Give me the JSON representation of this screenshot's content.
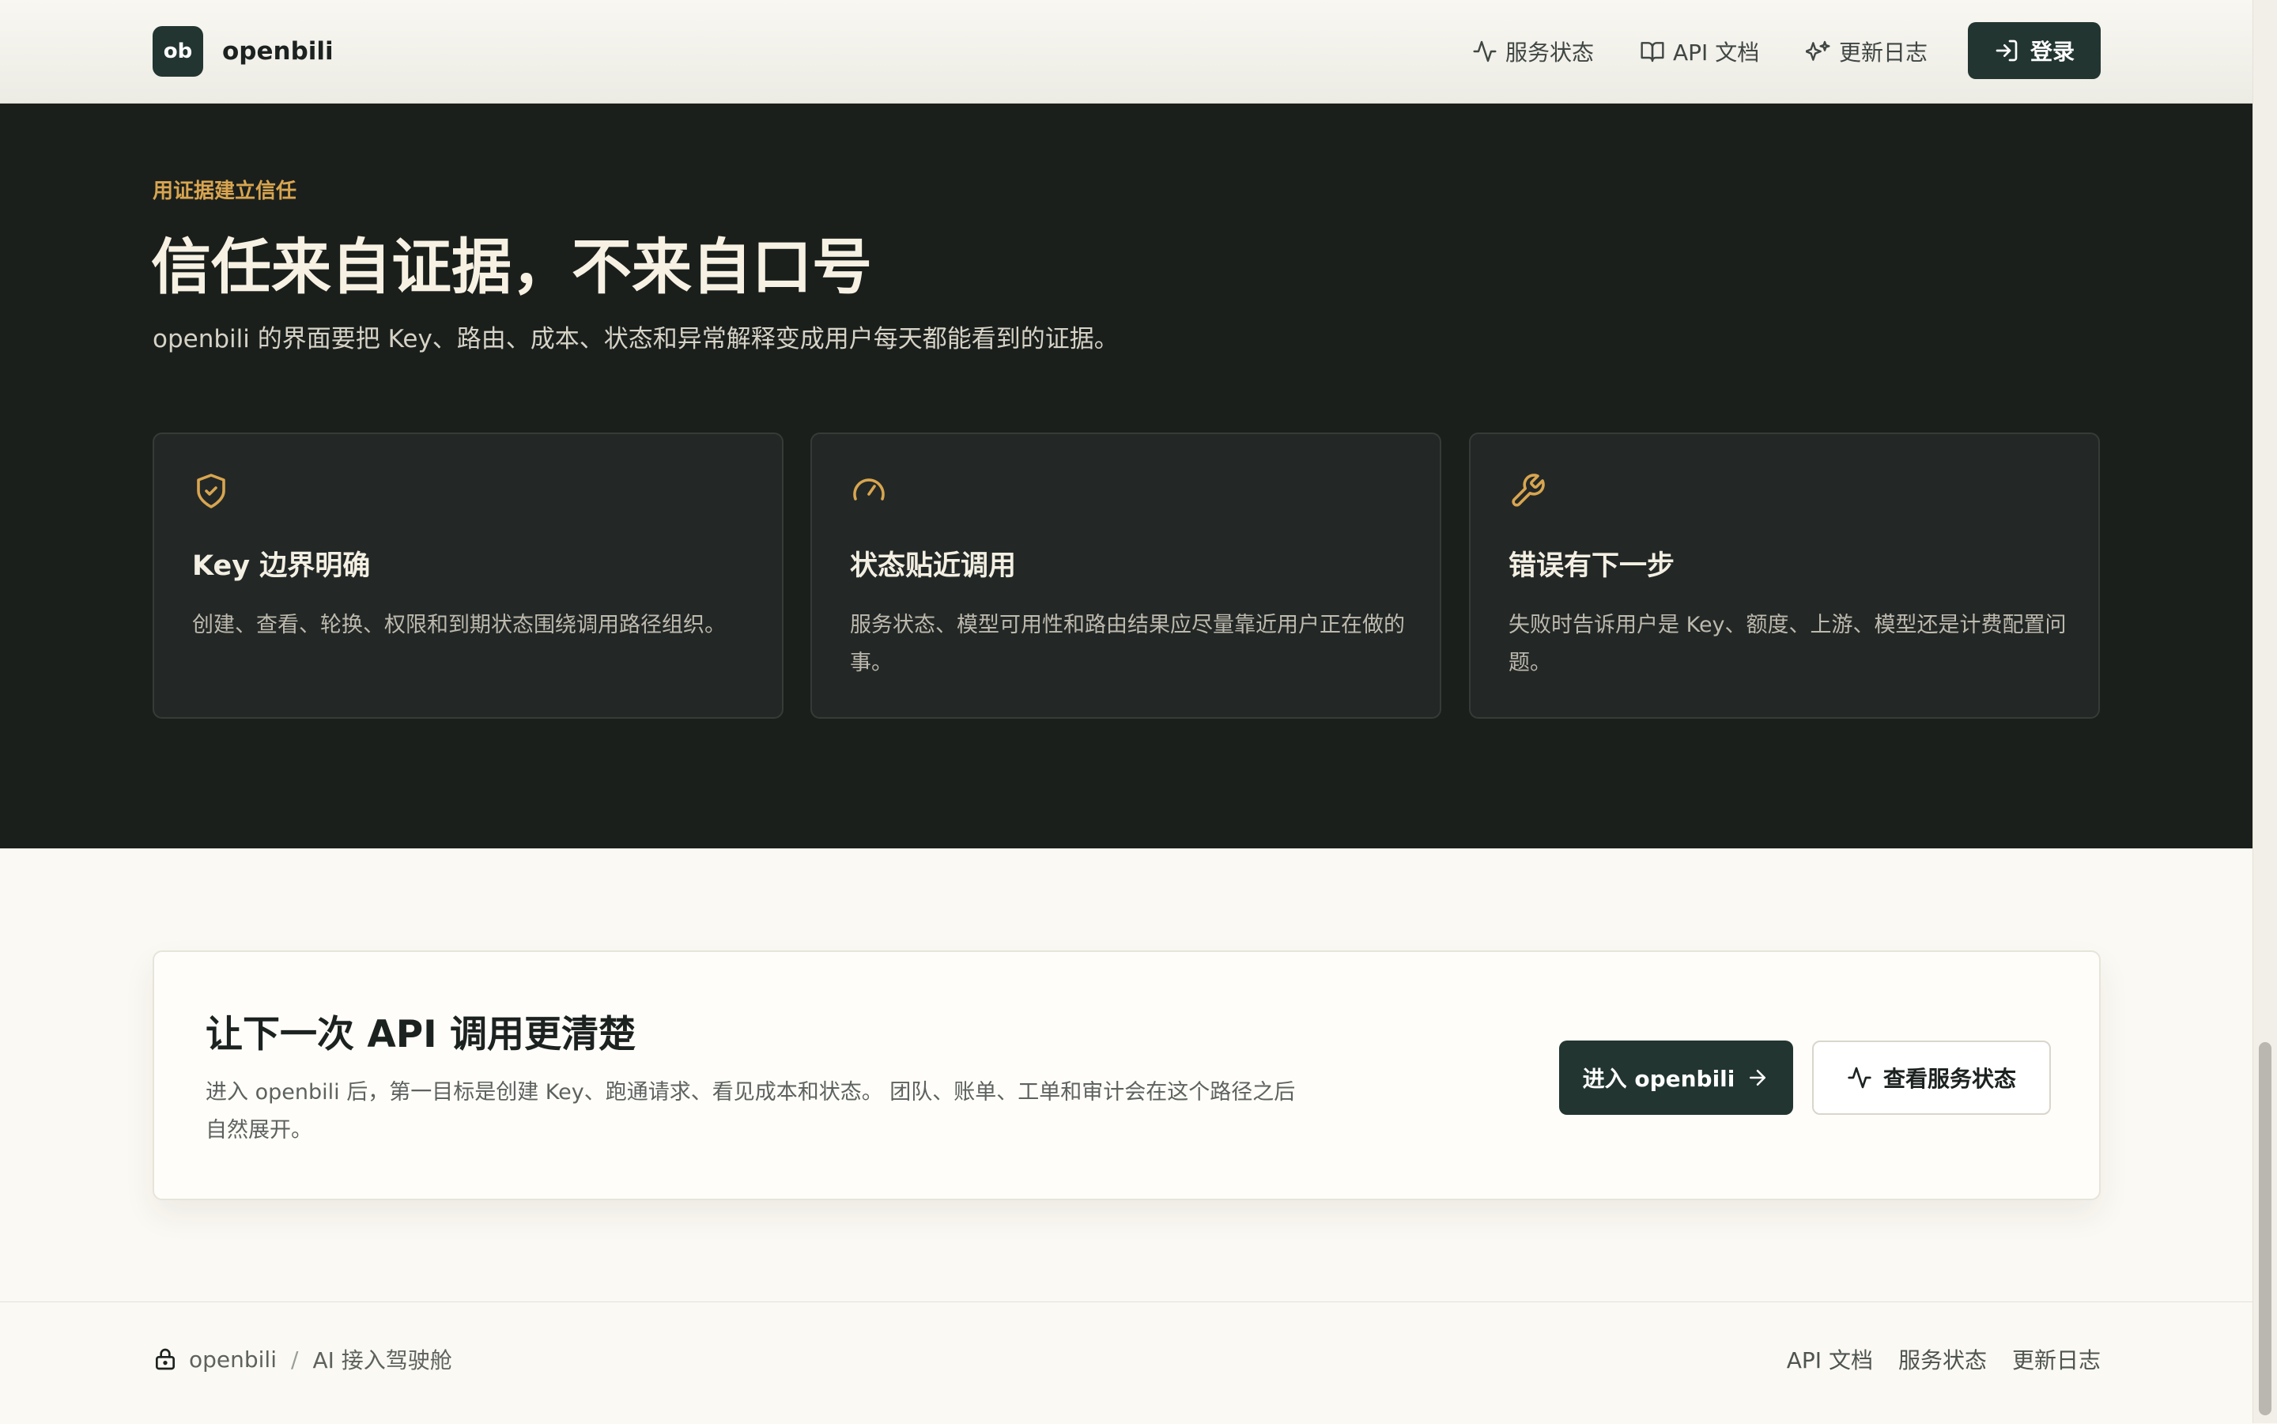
{
  "header": {
    "logo_text": "ob",
    "brand": "openbili",
    "nav": [
      {
        "label": "服务状态",
        "icon": "activity-icon"
      },
      {
        "label": "API 文档",
        "icon": "book-open-icon"
      },
      {
        "label": "更新日志",
        "icon": "sparkles-icon"
      }
    ],
    "login_label": "登录"
  },
  "hero": {
    "eyebrow": "用证据建立信任",
    "title": "信任来自证据，不来自口号",
    "subtitle": "openbili 的界面要把 Key、路由、成本、状态和异常解释变成用户每天都能看到的证据。",
    "cards": [
      {
        "icon": "shield-check-icon",
        "title": "Key 边界明确",
        "text": "创建、查看、轮换、权限和到期状态围绕调用路径组织。"
      },
      {
        "icon": "gauge-icon",
        "title": "状态贴近调用",
        "text": "服务状态、模型可用性和路由结果应尽量靠近用户正在做的事。"
      },
      {
        "icon": "wrench-icon",
        "title": "错误有下一步",
        "text": "失败时告诉用户是 Key、额度、上游、模型还是计费配置问题。"
      }
    ]
  },
  "cta": {
    "title": "让下一次 API 调用更清楚",
    "text": "进入 openbili 后，第一目标是创建 Key、跑通请求、看见成本和状态。 团队、账单、工单和审计会在这个路径之后自然展开。",
    "primary_label": "进入 openbili",
    "secondary_label": "查看服务状态"
  },
  "footer": {
    "brand": "openbili",
    "separator": "/",
    "tagline": "AI 接入驾驶舱",
    "links": [
      "API 文档",
      "服务状态",
      "更新日志"
    ]
  },
  "colors": {
    "accent_dark": "#223531",
    "hero_bg": "#1a1f1c",
    "gold": "#d8a550",
    "page_bg": "#fbf9f3"
  }
}
